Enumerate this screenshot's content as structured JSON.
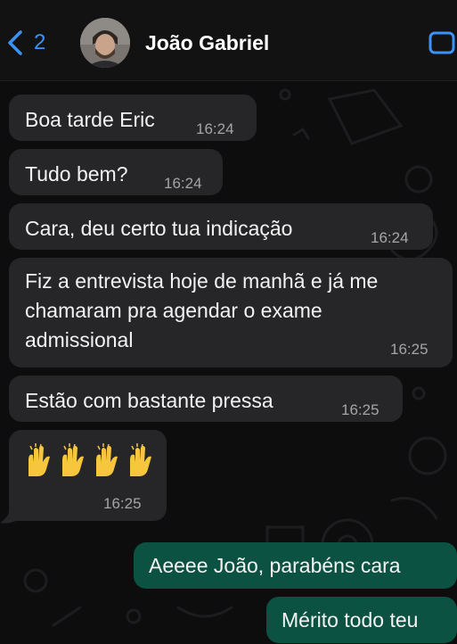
{
  "header": {
    "back_count": "2",
    "contact_name": "João Gabriel"
  },
  "messages": [
    {
      "direction": "in",
      "text": "Boa tarde Eric",
      "time": "16:24"
    },
    {
      "direction": "in",
      "text": "Tudo bem?",
      "time": "16:24"
    },
    {
      "direction": "in",
      "text": "Cara, deu certo tua indicação",
      "time": "16:24"
    },
    {
      "direction": "in",
      "lines": [
        "Fiz a entrevista hoje de manhã e já me",
        "chamaram pra agendar o exame",
        "admissional"
      ],
      "time": "16:25"
    },
    {
      "direction": "in",
      "text": "Estão com bastante pressa",
      "time": "16:25"
    },
    {
      "direction": "in",
      "emoji": "🙌🙌🙌🙌",
      "time": "16:25"
    },
    {
      "direction": "out",
      "text": "Aeeee João, parabéns cara"
    },
    {
      "direction": "out",
      "text": "Mérito todo teu"
    }
  ],
  "icons": {
    "back": "chevron-left-icon",
    "video": "video-call-icon",
    "emoji": "raising-hands-icon"
  },
  "colors": {
    "accent": "#3b93f7",
    "incoming_bubble": "#262628",
    "outgoing_bubble": "#0b5242",
    "background": "#0d0d0e"
  }
}
